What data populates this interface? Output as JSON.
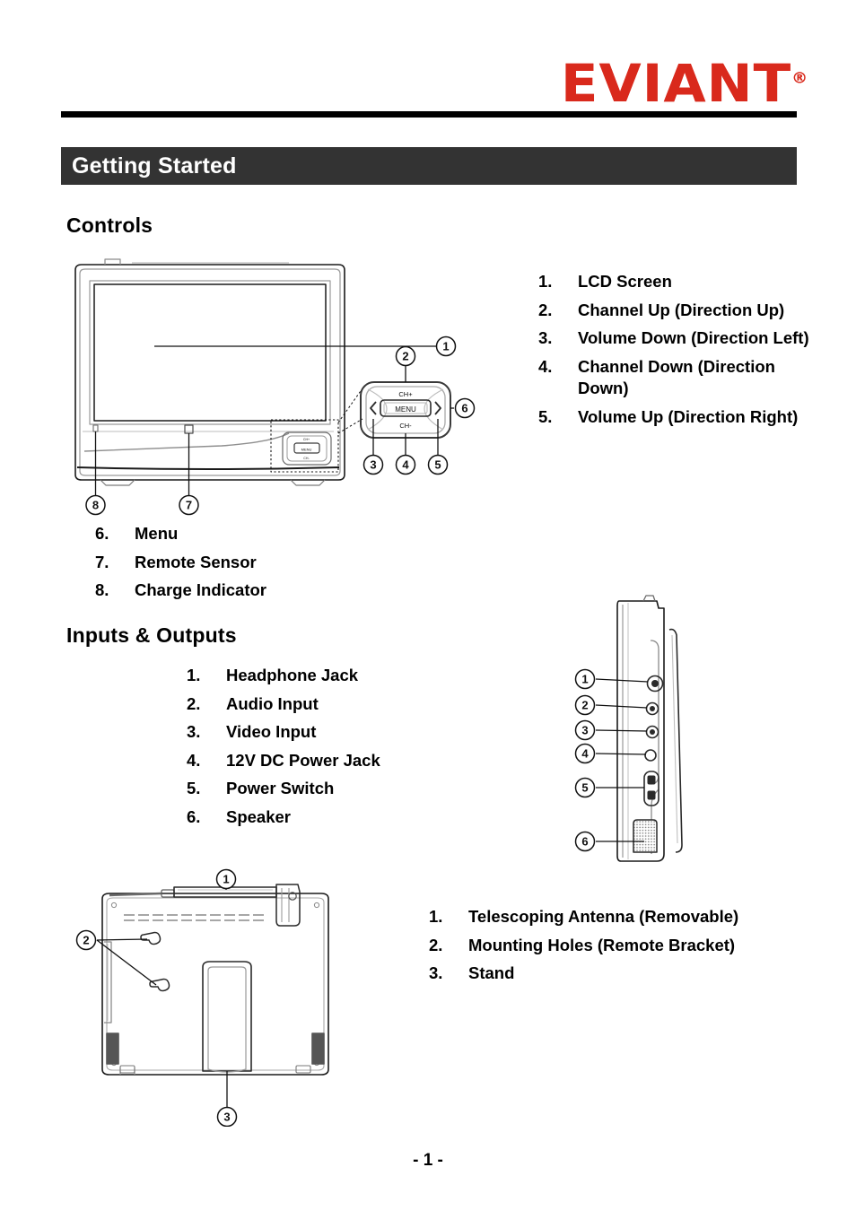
{
  "brand": {
    "logo_text": "EVIANT",
    "registered_mark": "®",
    "logo_color": "#D9291C"
  },
  "banner": {
    "title": "Getting Started",
    "background_color": "#333333",
    "text_color": "#FFFFFF"
  },
  "sections": {
    "controls": {
      "heading": "Controls",
      "items_right": [
        {
          "num": "1.",
          "label": "LCD Screen"
        },
        {
          "num": "2.",
          "label": "Channel Up (Direction Up)"
        },
        {
          "num": "3.",
          "label": "Volume Down (Direction Left)"
        },
        {
          "num": "4.",
          "label": "Channel Down (Direction Down)"
        },
        {
          "num": "5.",
          "label": "Volume Up (Direction Right)"
        }
      ],
      "items_below": [
        {
          "num": "6.",
          "label": "Menu"
        },
        {
          "num": "7.",
          "label": "Remote Sensor"
        },
        {
          "num": "8.",
          "label": "Charge Indicator"
        }
      ]
    },
    "inputs_outputs": {
      "heading": "Inputs & Outputs",
      "items": [
        {
          "num": "1.",
          "label": "Headphone Jack"
        },
        {
          "num": "2.",
          "label": "Audio Input"
        },
        {
          "num": "3.",
          "label": "Video Input"
        },
        {
          "num": "4.",
          "label": "12V DC Power Jack"
        },
        {
          "num": "5.",
          "label": "Power Switch"
        },
        {
          "num": "6.",
          "label": "Speaker"
        }
      ]
    },
    "rear": {
      "items": [
        {
          "num": "1.",
          "label": "Telescoping Antenna (Removable)"
        },
        {
          "num": "2.",
          "label": "Mounting Holes (Remote Bracket)"
        },
        {
          "num": "3.",
          "label": "Stand"
        }
      ]
    }
  },
  "figures": {
    "front_view": {
      "callouts": [
        "1",
        "2",
        "3",
        "4",
        "5",
        "6",
        "7",
        "8"
      ],
      "keypad_labels": {
        "up": "CH+",
        "down": "CH-",
        "center": "MENU",
        "left": "<",
        "right": ">"
      }
    },
    "side_view": {
      "callouts": [
        "1",
        "2",
        "3",
        "4",
        "5",
        "6"
      ]
    },
    "rear_view": {
      "callouts": [
        "1",
        "2",
        "3"
      ]
    }
  },
  "footer": {
    "page_number": "- 1 -"
  }
}
